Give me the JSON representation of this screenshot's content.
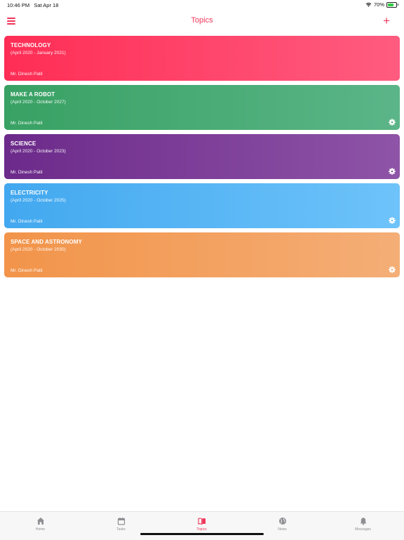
{
  "status_bar": {
    "time": "10:46 PM",
    "date": "Sat Apr 18",
    "battery": "70%",
    "battery_level": 0.7
  },
  "header": {
    "title": "Topics",
    "add_label": "+",
    "menu_icon": "hamburger-menu-icon"
  },
  "colors": {
    "accent": "#f0355a"
  },
  "topics": [
    {
      "title": "TECHNOLOGY",
      "period": "(April 2020 - January 2021)",
      "owner": "Mr. Dinesh Patil",
      "color_start": "#ff2d55",
      "color_end": "#ff5c80",
      "has_settings": false
    },
    {
      "title": "MAKE A ROBOT",
      "period": "(April 2020 - October 2027)",
      "owner": "Mr. Dinesh Patil",
      "color_start": "#38a163",
      "color_end": "#5bb588",
      "has_settings": true
    },
    {
      "title": "SCIENCE",
      "period": "(April 2020 - October 2023)",
      "owner": "Mr. Dinesh Patil",
      "color_start": "#6c2a8a",
      "color_end": "#8e54a7",
      "has_settings": true
    },
    {
      "title": "ELECTRICITY",
      "period": "(April 2020 - October 2025)",
      "owner": "Mr. Dinesh Patil",
      "color_start": "#42a8ef",
      "color_end": "#6ec3fa",
      "has_settings": true
    },
    {
      "title": "SPACE AND ASTRONOMY",
      "period": "(April 2020 - October 2030)",
      "owner": "Mr. Dinesh Patil",
      "color_start": "#f2944a",
      "color_end": "#f4ae76",
      "has_settings": true
    }
  ],
  "tabs": [
    {
      "label": "Home",
      "icon": "home-icon",
      "active": false
    },
    {
      "label": "Tasks",
      "icon": "calendar-icon",
      "active": false
    },
    {
      "label": "Topics",
      "icon": "book-icon",
      "active": true
    },
    {
      "label": "News",
      "icon": "globe-icon",
      "active": false
    },
    {
      "label": "Messages",
      "icon": "bell-icon",
      "active": false
    }
  ]
}
